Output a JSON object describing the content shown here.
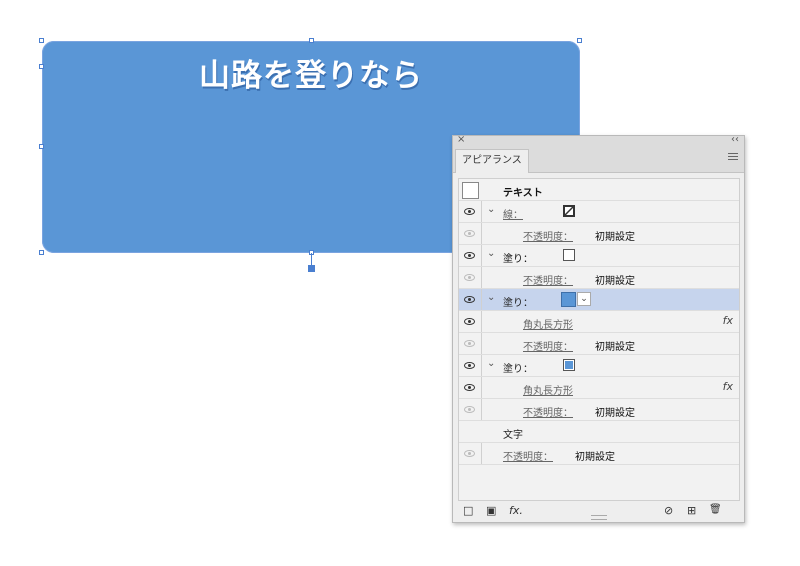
{
  "canvas": {
    "shape_text": "山路を登りなら",
    "shape_color": "#5a96d6"
  },
  "panel": {
    "close_glyph": "×",
    "collapse_glyph": "‹‹",
    "tab_label": "アピアランス",
    "object_type": "テキスト",
    "rows": {
      "stroke_label": "線：",
      "stroke_opacity_label": "不透明度：",
      "stroke_opacity_value": "初期設定",
      "fill1_label": "塗り：",
      "fill1_opacity_label": "不透明度：",
      "fill1_opacity_value": "初期設定",
      "fill2_label": "塗り：",
      "fill2_effect_label": "角丸長方形",
      "fill2_opacity_label": "不透明度：",
      "fill2_opacity_value": "初期設定",
      "fill3_label": "塗り：",
      "fill3_effect_label": "角丸長方形",
      "fill3_opacity_label": "不透明度：",
      "fill3_opacity_value": "初期設定",
      "characters_label": "文字",
      "text_opacity_label": "不透明度：",
      "text_opacity_value": "初期設定"
    },
    "fx_glyph": "fx",
    "fill_color": "#5a96d6",
    "selected_row_color": "#c6d4ed",
    "footer": {
      "add_stroke_icon": "□",
      "add_fill_icon": "▣",
      "fx_icon": "fx.",
      "clear_icon": "⊘",
      "duplicate_icon": "⊞",
      "delete_icon": "🗑"
    }
  }
}
